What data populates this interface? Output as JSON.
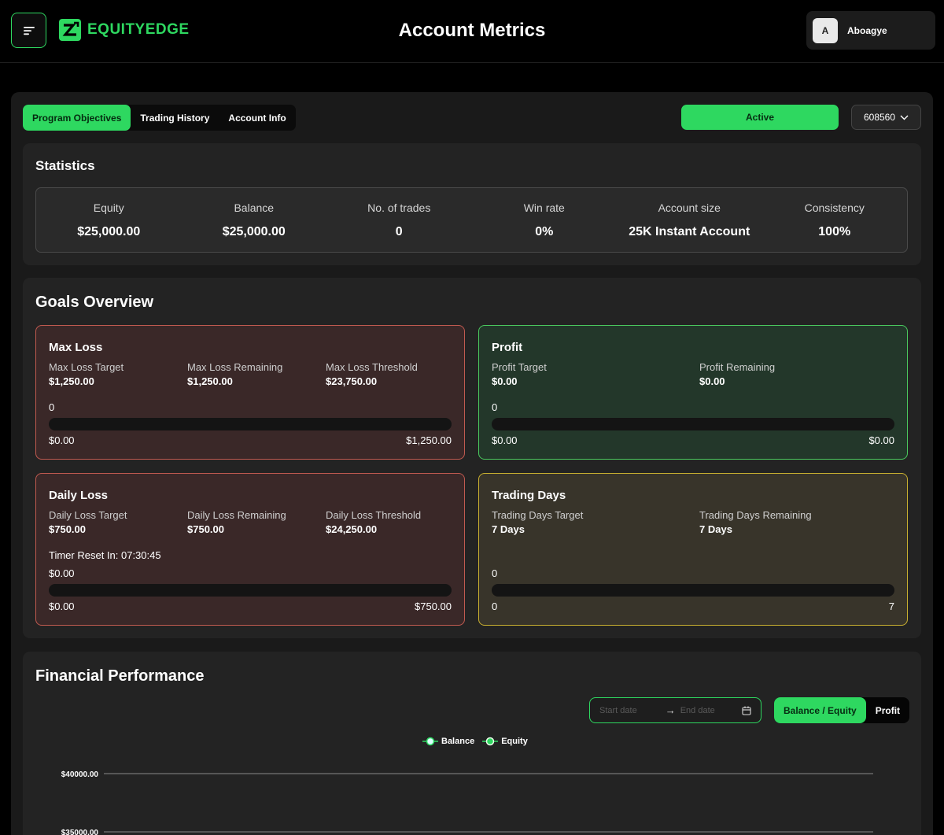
{
  "header": {
    "brand": "EQUITYEDGE",
    "title": "Account Metrics",
    "user_initial": "A",
    "user_name": "Aboagye"
  },
  "tabs": [
    "Program Objectives",
    "Trading History",
    "Account Info"
  ],
  "status": "Active",
  "account_number": "608560",
  "statistics": {
    "title": "Statistics",
    "items": [
      {
        "label": "Equity",
        "value": "$25,000.00"
      },
      {
        "label": "Balance",
        "value": "$25,000.00"
      },
      {
        "label": "No. of trades",
        "value": "0"
      },
      {
        "label": "Win rate",
        "value": "0%"
      },
      {
        "label": "Account size",
        "value": "25K Instant Account"
      },
      {
        "label": "Consistency",
        "value": "100%"
      }
    ]
  },
  "goals": {
    "title": "Goals Overview",
    "max_loss": {
      "title": "Max Loss",
      "items": [
        {
          "label": "Max Loss Target",
          "value": "$1,250.00"
        },
        {
          "label": "Max Loss Remaining",
          "value": "$1,250.00"
        },
        {
          "label": "Max Loss Threshold",
          "value": "$23,750.00"
        }
      ],
      "current": "0",
      "min": "$0.00",
      "max": "$1,250.00",
      "progress": 0
    },
    "profit": {
      "title": "Profit",
      "items": [
        {
          "label": "Profit Target",
          "value": "$0.00"
        },
        {
          "label": "Profit Remaining",
          "value": "$0.00"
        }
      ],
      "current": "0",
      "min": "$0.00",
      "max": "$0.00",
      "progress": 0
    },
    "daily_loss": {
      "title": "Daily Loss",
      "items": [
        {
          "label": "Daily Loss Target",
          "value": "$750.00"
        },
        {
          "label": "Daily Loss Remaining",
          "value": "$750.00"
        },
        {
          "label": "Daily Loss Threshold",
          "value": "$24,250.00"
        }
      ],
      "timer": "Timer Reset In: 07:30:45",
      "current": "$0.00",
      "min": "$0.00",
      "max": "$750.00",
      "progress": 0
    },
    "trading_days": {
      "title": "Trading Days",
      "items": [
        {
          "label": "Trading Days Target",
          "value": "7 Days"
        },
        {
          "label": "Trading Days Remaining",
          "value": "7 Days"
        }
      ],
      "current": "0",
      "min": "0",
      "max": "7",
      "progress": 0
    }
  },
  "financial": {
    "title": "Financial Performance",
    "start_placeholder": "Start date",
    "end_placeholder": "End date",
    "toggle": [
      "Balance / Equity",
      "Profit"
    ],
    "legend": [
      "Balance",
      "Equity"
    ]
  },
  "colors": {
    "accent": "#2ed860",
    "loss_border": "#c05a50",
    "profit_border": "#4ac95e",
    "days_border": "#c9b030"
  },
  "chart_data": {
    "type": "line",
    "series": [
      {
        "name": "Balance",
        "values": []
      },
      {
        "name": "Equity",
        "values": []
      }
    ],
    "y_tick_labels": [
      "$40000.00",
      "$35000.00"
    ],
    "grid": true,
    "legend": "top-center"
  }
}
